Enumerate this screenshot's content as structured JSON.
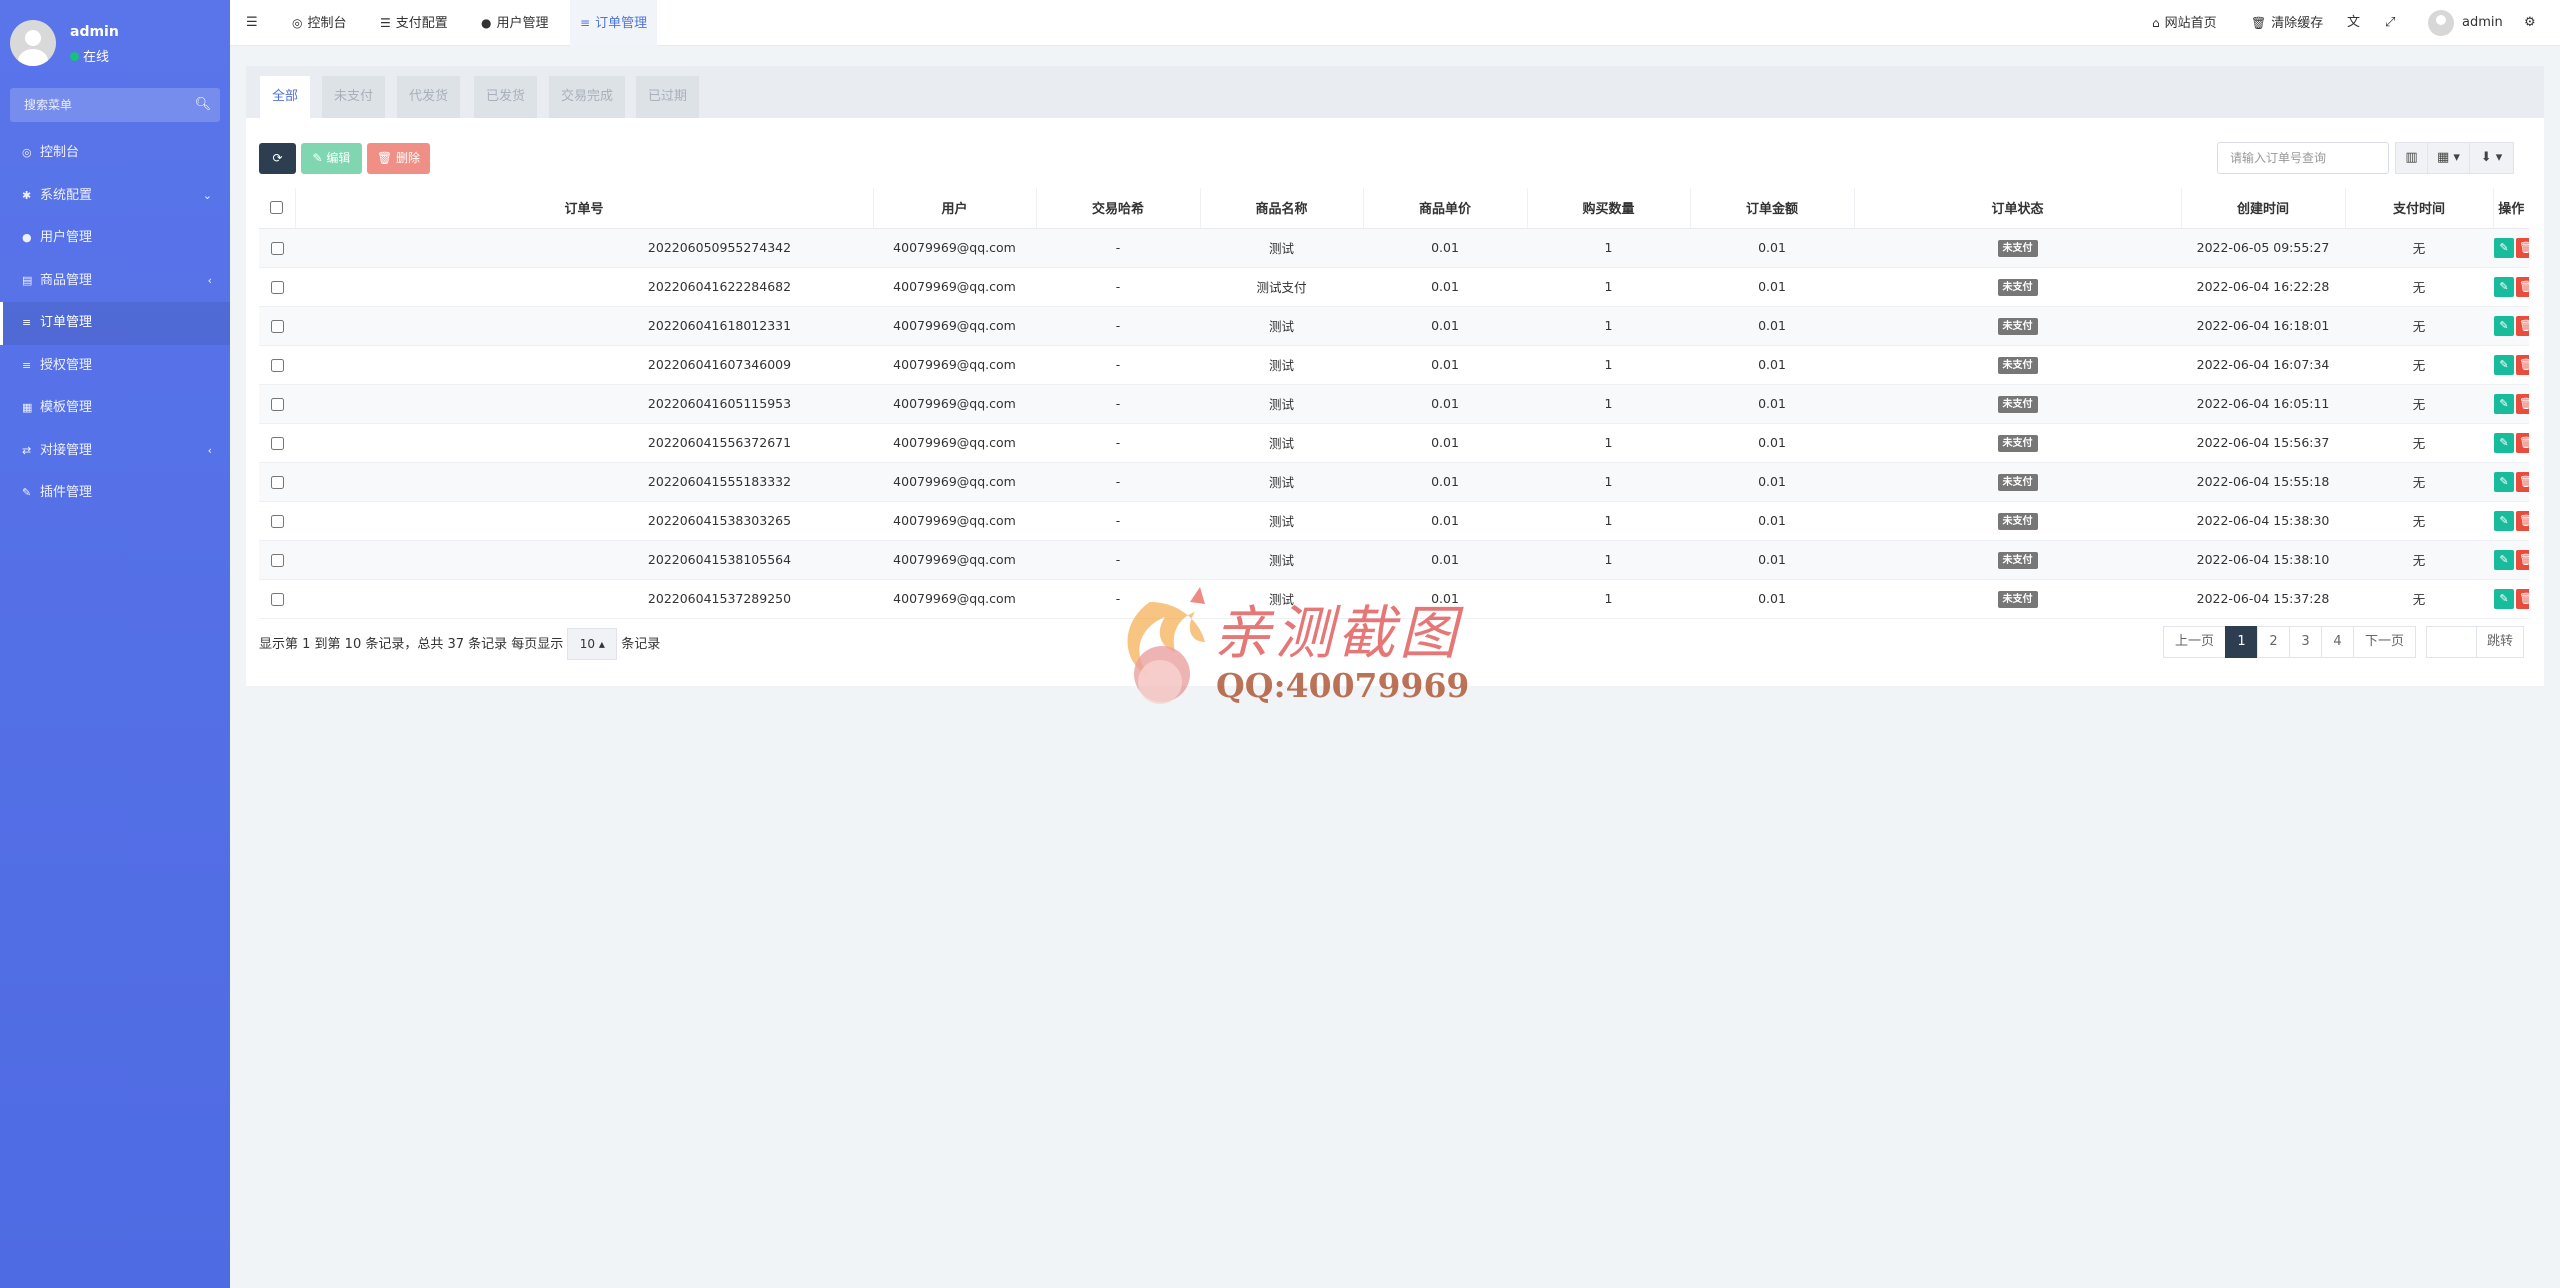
{
  "sidebar": {
    "user": {
      "name": "admin",
      "status": "在线"
    },
    "search_placeholder": "搜索菜单",
    "items": [
      {
        "label": "控制台",
        "icon": "dashboard-icon",
        "glyph": "◎",
        "arrow": ""
      },
      {
        "label": "系统配置",
        "icon": "gear-icon",
        "glyph": "✱",
        "arrow": "⌄"
      },
      {
        "label": "用户管理",
        "icon": "user-icon",
        "glyph": "●",
        "arrow": ""
      },
      {
        "label": "商品管理",
        "icon": "cart-icon",
        "glyph": "▤",
        "arrow": "‹"
      },
      {
        "label": "订单管理",
        "icon": "list-icon",
        "glyph": "≡",
        "arrow": "",
        "active": true
      },
      {
        "label": "授权管理",
        "icon": "list-icon",
        "glyph": "≡",
        "arrow": ""
      },
      {
        "label": "模板管理",
        "icon": "table-icon",
        "glyph": "▦",
        "arrow": ""
      },
      {
        "label": "对接管理",
        "icon": "exchange-icon",
        "glyph": "⇄",
        "arrow": "‹"
      },
      {
        "label": "插件管理",
        "icon": "plugin-icon",
        "glyph": "✎",
        "arrow": ""
      }
    ]
  },
  "topbar": {
    "tabs": [
      {
        "label": "控制台",
        "icon": "dashboard-icon",
        "glyph": "◎"
      },
      {
        "label": "支付配置",
        "icon": "list-icon",
        "glyph": "☰"
      },
      {
        "label": "用户管理",
        "icon": "user-icon",
        "glyph": "●"
      },
      {
        "label": "订单管理",
        "icon": "list-icon",
        "glyph": "≡",
        "active": true
      }
    ],
    "right": {
      "site_home": "网站首页",
      "clear_cache": "清除缓存",
      "user": "admin"
    }
  },
  "order_tabs": [
    "全部",
    "未支付",
    "代发货",
    "已发货",
    "交易完成",
    "已过期"
  ],
  "toolbar": {
    "edit_label": "编辑",
    "delete_label": "删除",
    "search_placeholder": "请输入订单号查询"
  },
  "table": {
    "columns": [
      "订单号",
      "用户",
      "交易哈希",
      "商品名称",
      "商品单价",
      "购买数量",
      "订单金额",
      "订单状态",
      "创建时间",
      "支付时间",
      "操作"
    ],
    "rows": [
      {
        "order_no": "202206050955274342",
        "user": "40079969@qq.com",
        "hash": "-",
        "product": "测试",
        "price": "0.01",
        "qty": "1",
        "amount": "0.01",
        "status": "未支付",
        "created": "2022-06-05 09:55:27",
        "paid": "无"
      },
      {
        "order_no": "202206041622284682",
        "user": "40079969@qq.com",
        "hash": "-",
        "product": "测试支付",
        "price": "0.01",
        "qty": "1",
        "amount": "0.01",
        "status": "未支付",
        "created": "2022-06-04 16:22:28",
        "paid": "无"
      },
      {
        "order_no": "202206041618012331",
        "user": "40079969@qq.com",
        "hash": "-",
        "product": "测试",
        "price": "0.01",
        "qty": "1",
        "amount": "0.01",
        "status": "未支付",
        "created": "2022-06-04 16:18:01",
        "paid": "无"
      },
      {
        "order_no": "202206041607346009",
        "user": "40079969@qq.com",
        "hash": "-",
        "product": "测试",
        "price": "0.01",
        "qty": "1",
        "amount": "0.01",
        "status": "未支付",
        "created": "2022-06-04 16:07:34",
        "paid": "无"
      },
      {
        "order_no": "202206041605115953",
        "user": "40079969@qq.com",
        "hash": "-",
        "product": "测试",
        "price": "0.01",
        "qty": "1",
        "amount": "0.01",
        "status": "未支付",
        "created": "2022-06-04 16:05:11",
        "paid": "无"
      },
      {
        "order_no": "202206041556372671",
        "user": "40079969@qq.com",
        "hash": "-",
        "product": "测试",
        "price": "0.01",
        "qty": "1",
        "amount": "0.01",
        "status": "未支付",
        "created": "2022-06-04 15:56:37",
        "paid": "无"
      },
      {
        "order_no": "202206041555183332",
        "user": "40079969@qq.com",
        "hash": "-",
        "product": "测试",
        "price": "0.01",
        "qty": "1",
        "amount": "0.01",
        "status": "未支付",
        "created": "2022-06-04 15:55:18",
        "paid": "无"
      },
      {
        "order_no": "202206041538303265",
        "user": "40079969@qq.com",
        "hash": "-",
        "product": "测试",
        "price": "0.01",
        "qty": "1",
        "amount": "0.01",
        "status": "未支付",
        "created": "2022-06-04 15:38:30",
        "paid": "无"
      },
      {
        "order_no": "202206041538105564",
        "user": "40079969@qq.com",
        "hash": "-",
        "product": "测试",
        "price": "0.01",
        "qty": "1",
        "amount": "0.01",
        "status": "未支付",
        "created": "2022-06-04 15:38:10",
        "paid": "无"
      },
      {
        "order_no": "202206041537289250",
        "user": "40079969@qq.com",
        "hash": "-",
        "product": "测试",
        "price": "0.01",
        "qty": "1",
        "amount": "0.01",
        "status": "未支付",
        "created": "2022-06-04 15:37:28",
        "paid": "无"
      }
    ]
  },
  "pagination": {
    "info": "显示第 1 到第 10 条记录，总共 37 条记录 每页显示",
    "page_size": "10",
    "suffix": "条记录",
    "prev": "上一页",
    "pages": [
      "1",
      "2",
      "3",
      "4"
    ],
    "current": "1",
    "next": "下一页",
    "jump": "跳转"
  },
  "watermark": {
    "title": "亲测截图",
    "subtitle": "QQ:40079969"
  },
  "colors": {
    "sidebar": "#5470e8",
    "primary": "#4e73df",
    "dark_button": "#2c3e50",
    "success": "#18bc9c",
    "danger": "#e74c3c",
    "badge": "#777777"
  }
}
